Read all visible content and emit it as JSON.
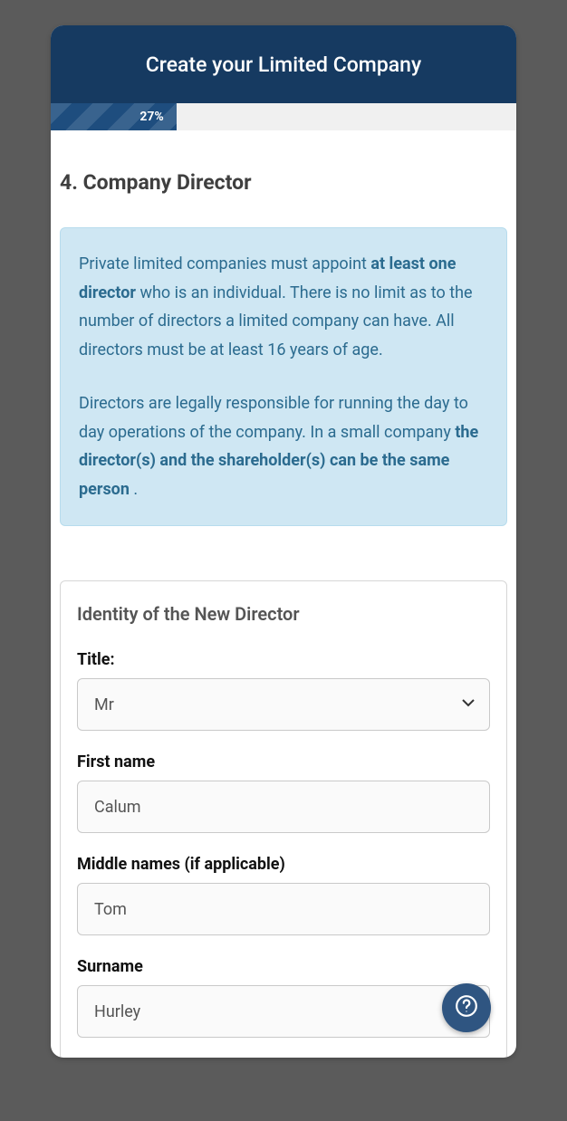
{
  "header": {
    "title": "Create your Limited Company"
  },
  "progress": {
    "percent_label": "27%",
    "percent_value": 27
  },
  "step": {
    "heading": "4. Company Director"
  },
  "info": {
    "p1_a": "Private limited companies must appoint ",
    "p1_b": "at least one director",
    "p1_c": " who is an individual. There is no limit as to the number of directors a limited company can have. All directors must be at least 16 years of age.",
    "p2_a": "Directors are legally responsible for running the day to day operations of the company. In a small company ",
    "p2_b": "the director(s) and the shareholder(s) can be the same person",
    "p2_c": " ."
  },
  "form": {
    "section_title": "Identity of the New Director",
    "fields": {
      "title": {
        "label": "Title:",
        "value": "Mr"
      },
      "first_name": {
        "label": "First name",
        "value": "Calum"
      },
      "middle_names": {
        "label": "Middle names (if applicable)",
        "value": "Tom"
      },
      "surname": {
        "label": "Surname",
        "value": "Hurley"
      }
    }
  }
}
